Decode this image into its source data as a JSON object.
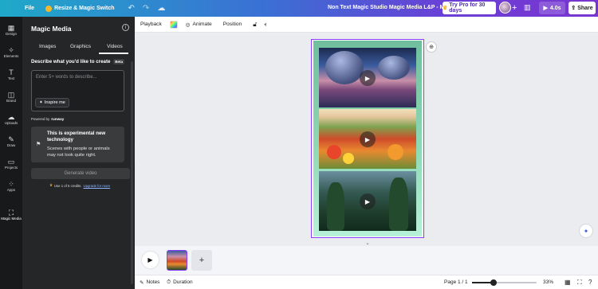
{
  "topbar": {
    "file_label": "File",
    "resize_label": "Resize & Magic Switch",
    "document_title": "Non Text Magic Studio Magic Media L&P - MOBILE",
    "pro_label": "Try Pro for 30 days",
    "play_label": "4.0s",
    "share_label": "Share"
  },
  "rail": {
    "items": [
      {
        "label": "Design",
        "icon": "design-icon"
      },
      {
        "label": "Elements",
        "icon": "elements-icon"
      },
      {
        "label": "Text",
        "icon": "text-icon"
      },
      {
        "label": "Brand",
        "icon": "brand-icon"
      },
      {
        "label": "Uploads",
        "icon": "uploads-icon"
      },
      {
        "label": "Draw",
        "icon": "draw-icon"
      },
      {
        "label": "Projects",
        "icon": "projects-icon"
      },
      {
        "label": "Apps",
        "icon": "apps-icon"
      },
      {
        "label": "Magic Media",
        "icon": "magic-media-icon",
        "active": true
      }
    ]
  },
  "panel": {
    "title": "Magic Media",
    "tabs": [
      {
        "label": "Images"
      },
      {
        "label": "Graphics"
      },
      {
        "label": "Videos",
        "active": true
      }
    ],
    "describe_label": "Describe what you'd like to create",
    "beta_badge": "Beta",
    "prompt_placeholder": "Enter 5+ words to describe...",
    "inspire_label": "Inspire me",
    "powered_by": "Powered by",
    "powered_brand": "runway",
    "notice_title": "This is experimental new technology",
    "notice_body": "Scenes with people or animals may not look quite right.",
    "generate_label": "Generate video",
    "credits_text": "Use 1 of 5 credits.",
    "upgrade_link": "Upgrade for more"
  },
  "toolbar": {
    "playback_label": "Playback",
    "animate_label": "Animate",
    "position_label": "Position"
  },
  "canvas": {
    "accent_color": "#8b3dff",
    "tiles": [
      {
        "name": "alien-planet-scene"
      },
      {
        "name": "flower-field-scene"
      },
      {
        "name": "forest-scene"
      }
    ]
  },
  "statusbar": {
    "notes_label": "Notes",
    "duration_label": "Duration",
    "page_indicator": "Page 1 / 1",
    "zoom_label": "33%",
    "zoom_fraction": 0.33
  }
}
